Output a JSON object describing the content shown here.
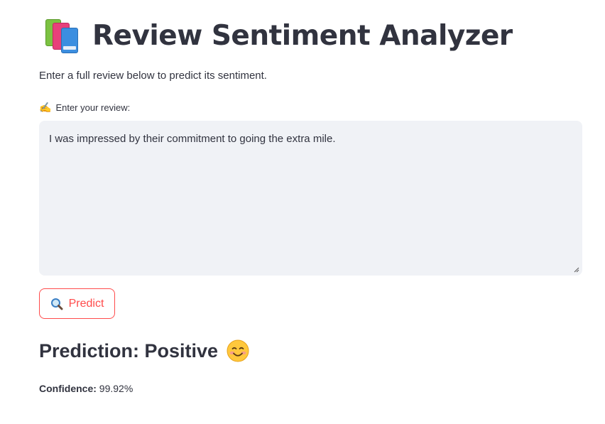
{
  "header": {
    "title": "Review Sentiment Analyzer",
    "icon": "books-icon"
  },
  "subtitle": "Enter a full review below to predict its sentiment.",
  "review_input": {
    "label_icon": "writing-hand-icon",
    "label": "Enter your review:",
    "value": "I was impressed by their commitment to going the extra mile."
  },
  "predict_button": {
    "icon": "magnifying-glass-icon",
    "label": "Predict"
  },
  "result": {
    "prediction_text": "Prediction: Positive",
    "emoji_icon": "smiling-face-icon",
    "confidence_label": "Confidence:",
    "confidence_value": "99.92%"
  },
  "colors": {
    "accent": "#ff4b4b",
    "text": "#31333f",
    "input_bg": "#f0f2f6"
  }
}
